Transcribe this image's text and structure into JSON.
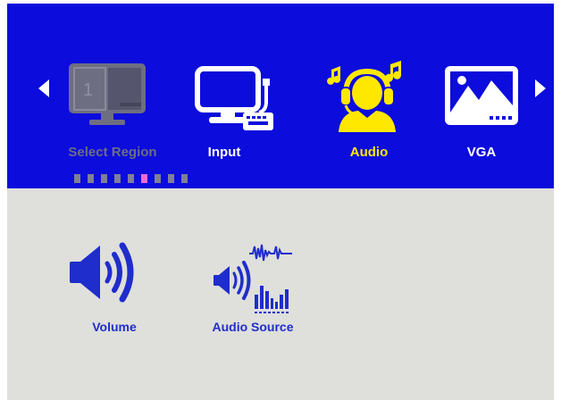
{
  "menu": {
    "tabs": [
      {
        "label": "Select Region",
        "icon": "monitor-split-icon",
        "state": "disabled",
        "color": "#6e6e82"
      },
      {
        "label": "Input",
        "icon": "computer-input-icon",
        "state": "normal",
        "color": "#ffffff"
      },
      {
        "label": "Audio",
        "icon": "headphones-user-icon",
        "state": "selected",
        "color": "#ffe800"
      },
      {
        "label": "VGA",
        "icon": "vga-picture-icon",
        "state": "normal",
        "color": "#ffffff"
      }
    ],
    "page_indicator": {
      "total": 9,
      "active": 6,
      "active_color": "#f06ad6",
      "inactive_color": "#7f7f98"
    },
    "region_number": "1"
  },
  "content": {
    "items": [
      {
        "label": "Volume",
        "icon": "speaker-volume-icon"
      },
      {
        "label": "Audio Source",
        "icon": "audio-source-icon"
      }
    ]
  },
  "colors": {
    "header_bg": "#0c0cdc",
    "content_bg": "#dfdfdb",
    "content_icon": "#1f2dcc"
  }
}
